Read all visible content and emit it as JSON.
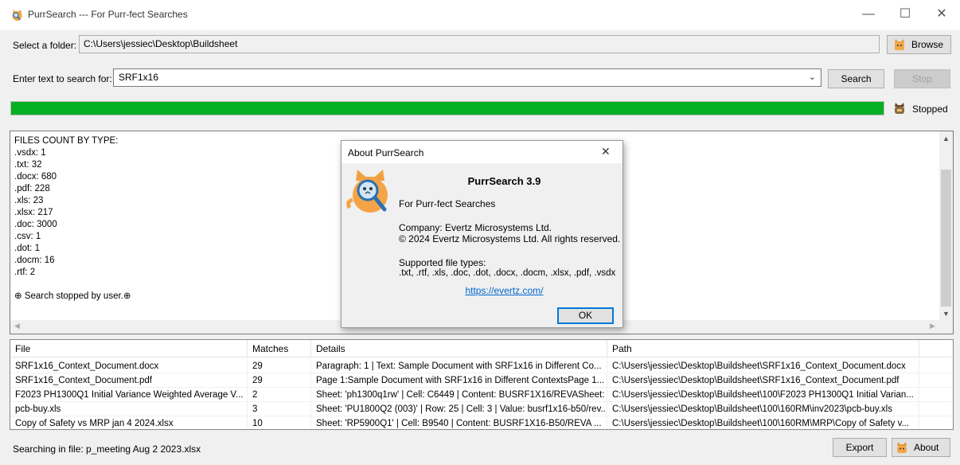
{
  "window": {
    "title": "PurrSearch --- For Purr-fect Searches",
    "minimize": "—",
    "maximize": "☐",
    "close": "✕"
  },
  "folder": {
    "label": "Select a folder:",
    "value": "C:\\Users\\jessiec\\Desktop\\Buildsheet",
    "browse_label": "Browse"
  },
  "search": {
    "label": "Enter text to search for:",
    "value": "SRF1x16",
    "search_label": "Search",
    "stop_label": "Stop"
  },
  "progress": {
    "fraction": 1.0,
    "color": "#06b025",
    "status": "Stopped"
  },
  "results_text": "FILES COUNT BY TYPE:\n.vsdx: 1\n.txt: 32\n.docx: 680\n.pdf: 228\n.xls: 23\n.xlsx: 217\n.doc: 3000\n.csv: 1\n.dot: 1\n.docm: 16\n.rtf: 2\n\n⊕ Search stopped by user.⊕",
  "table": {
    "columns": [
      "File",
      "Matches",
      "Details",
      "Path"
    ],
    "rows": [
      [
        "SRF1x16_Context_Document.docx",
        "29",
        "Paragraph: 1 | Text: Sample Document with SRF1x16 in Different Co...",
        "C:\\Users\\jessiec\\Desktop\\Buildsheet\\SRF1x16_Context_Document.docx"
      ],
      [
        "SRF1x16_Context_Document.pdf",
        "29",
        "Page 1:Sample Document with SRF1x16 in Different ContextsPage 1...",
        "C:\\Users\\jessiec\\Desktop\\Buildsheet\\SRF1x16_Context_Document.pdf"
      ],
      [
        "F2023 PH1300Q1 Initial Variance Weighted Average V...",
        "2",
        "Sheet: 'ph1300q1rw' | Cell: C6449 | Content: BUSRF1X16/REVASheet: ...",
        "C:\\Users\\jessiec\\Desktop\\Buildsheet\\100\\F2023 PH1300Q1 Initial Varian..."
      ],
      [
        "pcb-buy.xls",
        "3",
        "Sheet: 'PU1800Q2 (003)' | Row: 25 | Cell: 3 | Value: busrf1x16-b50/rev...",
        "C:\\Users\\jessiec\\Desktop\\Buildsheet\\100\\160RM\\inv2023\\pcb-buy.xls"
      ],
      [
        "Copy of Safety vs MRP jan 4 2024.xlsx",
        "10",
        "Sheet: 'RP5900Q1' | Cell: B9540 | Content: BUSRF1X16-B50/REVA      ...",
        "C:\\Users\\jessiec\\Desktop\\Buildsheet\\100\\160RM\\MRP\\Copy of Safety v..."
      ]
    ]
  },
  "status_bar": {
    "text": "Searching in file: p_meeting Aug 2 2023.xlsx",
    "export_label": "Export",
    "about_label": "About"
  },
  "about_dialog": {
    "title": "About PurrSearch",
    "close": "✕",
    "product": "PurrSearch 3.9",
    "tagline": "For Purr-fect Searches",
    "company": "Company: Evertz Microsystems Ltd.",
    "copyright": "© 2024 Evertz Microsystems Ltd. All rights reserved.",
    "supported_label": "Supported file types:",
    "supported_types": ".txt, .rtf, .xls, .doc, .dot, .docx, .docm, .xlsx, .pdf, .vsdx",
    "link": "https://evertz.com/",
    "ok_label": "OK"
  },
  "icons": {
    "app": "cat-magnifier-icon",
    "browse": "cat-folder-icon",
    "status": "cat-status-icon",
    "about": "cat-about-icon"
  }
}
